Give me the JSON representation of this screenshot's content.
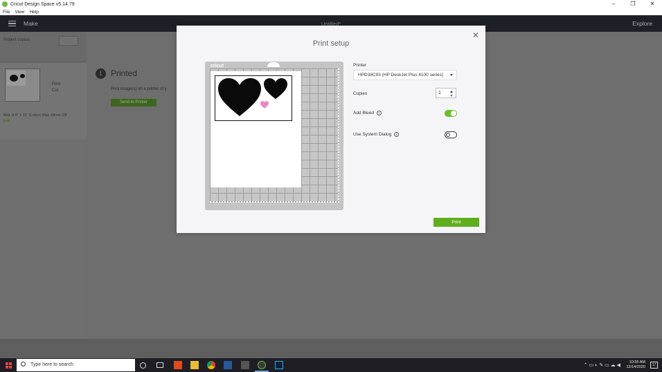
{
  "window": {
    "title": "Cricut Design Space  v5.14.79",
    "controls": [
      "–",
      "❐",
      "✕"
    ]
  },
  "menu": [
    "File",
    "View",
    "Help"
  ],
  "header": {
    "make": "Make",
    "doc_title": "Untitled*",
    "explore": "Explore"
  },
  "left_panel": {
    "project_copies_label": "Project copies:",
    "mat_modes": [
      "Print",
      "Cut"
    ],
    "mat_info": "Mat, 8.5\" x 11\" (Letter) Mat, Mirror Off",
    "edit_label": "Edit"
  },
  "main": {
    "step_number": "1",
    "step_title": "Printed",
    "step_desc": "Print image(s) on a printer of y",
    "send_button": "Send to Printer"
  },
  "dialog": {
    "title": "Print setup",
    "close": "✕",
    "mat_brand": "cricut",
    "printer_label": "Printer",
    "printer_value": "HPD38C93 (HP DeskJet Plus 4100 series)",
    "copies_label": "Copies",
    "copies_value": "1",
    "add_bleed_label": "Add Bleed",
    "add_bleed_on": true,
    "system_dialog_label": "Use System Dialog",
    "system_dialog_on": false,
    "info_icon": "i",
    "print_button": "Print"
  },
  "taskbar": {
    "search_placeholder": "Type here to search",
    "time": "10:55 AM",
    "date": "12/14/2020",
    "notification_count": "17"
  },
  "colors": {
    "accent_green": "#6cbd2d",
    "print_button": "#5fae1e",
    "pink_heart": "#e889c7",
    "header_bg": "#1d2127"
  }
}
